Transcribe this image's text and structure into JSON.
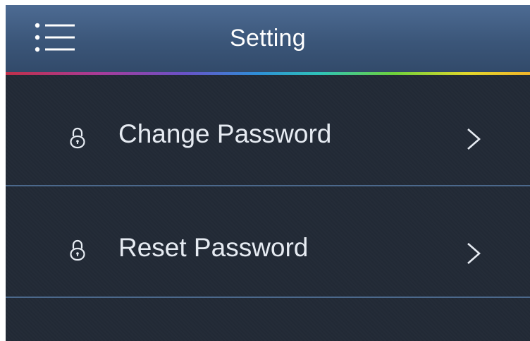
{
  "header": {
    "title": "Setting",
    "menu_icon": "menu-list-icon"
  },
  "colors": {
    "header_top": "#4d6b93",
    "background": "#222a36",
    "divider": "#52739a",
    "text": "#e6ebf2"
  },
  "items": [
    {
      "label": "Change Password",
      "icon": "lock-icon",
      "trailing_icon": "chevron-right-icon"
    },
    {
      "label": "Reset Password",
      "icon": "lock-icon",
      "trailing_icon": "chevron-right-icon"
    }
  ]
}
